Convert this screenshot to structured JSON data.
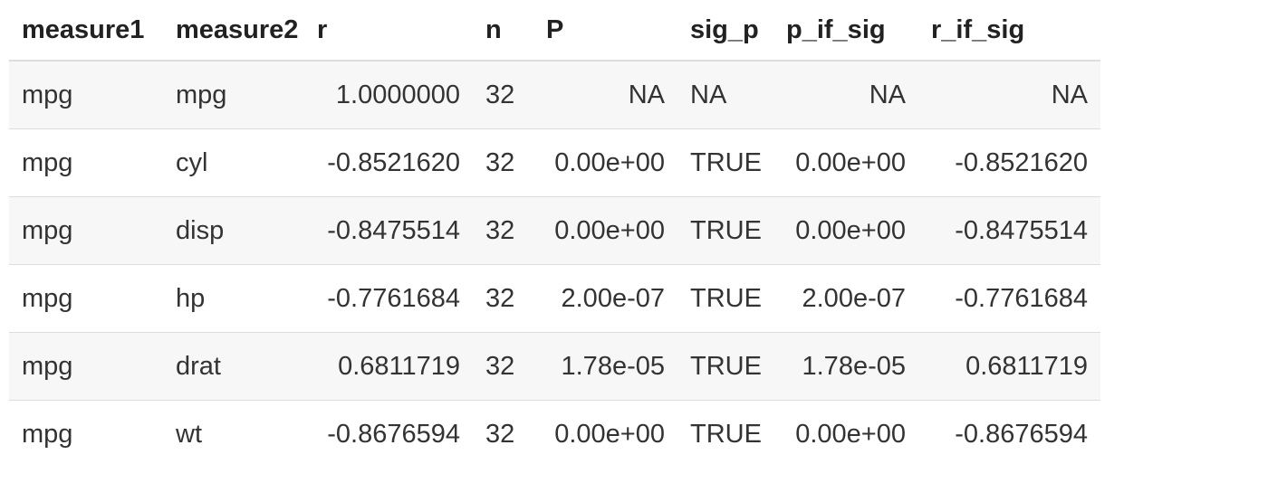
{
  "table": {
    "headers": [
      "measure1",
      "measure2",
      "r",
      "n",
      "P",
      "sig_p",
      "p_if_sig",
      "r_if_sig"
    ],
    "rows": [
      [
        "mpg",
        "mpg",
        "1.0000000",
        "32",
        "NA",
        "NA",
        "NA",
        "NA"
      ],
      [
        "mpg",
        "cyl",
        "-0.8521620",
        "32",
        "0.00e+00",
        "TRUE",
        "0.00e+00",
        "-0.8521620"
      ],
      [
        "mpg",
        "disp",
        "-0.8475514",
        "32",
        "0.00e+00",
        "TRUE",
        "0.00e+00",
        "-0.8475514"
      ],
      [
        "mpg",
        "hp",
        "-0.7761684",
        "32",
        "2.00e-07",
        "TRUE",
        "2.00e-07",
        "-0.7761684"
      ],
      [
        "mpg",
        "drat",
        "0.6811719",
        "32",
        "1.78e-05",
        "TRUE",
        "1.78e-05",
        "0.6811719"
      ],
      [
        "mpg",
        "wt",
        "-0.8676594",
        "32",
        "0.00e+00",
        "TRUE",
        "0.00e+00",
        "-0.8676594"
      ]
    ]
  }
}
